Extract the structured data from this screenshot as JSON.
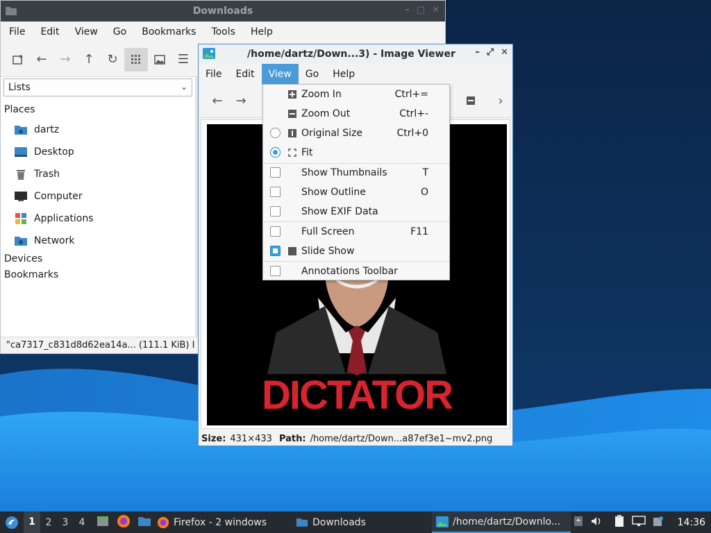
{
  "colors": {
    "accent": "#4a9bd8",
    "titlebar_dark": "#3a3f44",
    "taskbar": "#252a30",
    "wallpaper_dark": "#0d2a4e",
    "wallpaper_light": "#1e8ce8"
  },
  "file_manager": {
    "title": "Downloads",
    "menu": [
      "File",
      "Edit",
      "View",
      "Go",
      "Bookmarks",
      "Tools",
      "Help"
    ],
    "toolbar": [
      "new-tab-icon",
      "back-icon",
      "forward-icon",
      "up-icon",
      "reload-icon",
      "icon-view-icon",
      "thumbnail-view-icon",
      "list-view-icon"
    ],
    "side_pane_mode": "Lists",
    "places_label": "Places",
    "places": [
      {
        "label": "dartz",
        "icon": "home-folder-icon"
      },
      {
        "label": "Desktop",
        "icon": "desktop-icon"
      },
      {
        "label": "Trash",
        "icon": "trash-icon"
      },
      {
        "label": "Computer",
        "icon": "computer-icon"
      },
      {
        "label": "Applications",
        "icon": "applications-icon"
      },
      {
        "label": "Network",
        "icon": "network-icon"
      }
    ],
    "devices_label": "Devices",
    "bookmarks_label": "Bookmarks",
    "status": "\"ca7317_c831d8d62ea14a... (111.1 KiB) I"
  },
  "image_viewer": {
    "title": "/home/dartz/Down...3) - Image Viewer",
    "menu": [
      "File",
      "Edit",
      "View",
      "Go",
      "Help"
    ],
    "active_menu": "View",
    "image_caption": "DICTATOR",
    "status": {
      "size_label": "Size:",
      "size_value": "431×433",
      "path_label": "Path:",
      "path_value": "/home/dartz/Down...a87ef3e1~mv2.png"
    }
  },
  "view_menu": {
    "zoom_in": {
      "label": "Zoom In",
      "shortcut": "Ctrl+="
    },
    "zoom_out": {
      "label": "Zoom Out",
      "shortcut": "Ctrl+-"
    },
    "original_size": {
      "label": "Original Size",
      "shortcut": "Ctrl+0",
      "selected": false
    },
    "fit": {
      "label": "Fit",
      "selected": true
    },
    "show_thumbnails": {
      "label": "Show Thumbnails",
      "shortcut": "T",
      "checked": false
    },
    "show_outline": {
      "label": "Show Outline",
      "shortcut": "O",
      "checked": false
    },
    "show_exif": {
      "label": "Show EXIF Data",
      "checked": false
    },
    "full_screen": {
      "label": "Full Screen",
      "shortcut": "F11",
      "checked": false
    },
    "slide_show": {
      "label": "Slide Show",
      "checked": true
    },
    "annotations_toolbar": {
      "label": "Annotations Toolbar",
      "checked": false
    }
  },
  "taskbar": {
    "workspaces": [
      "1",
      "2",
      "3",
      "4"
    ],
    "current_workspace": "1",
    "tasks": {
      "firefox": "Firefox - 2 windows",
      "downloads": "Downloads",
      "viewer": "/home/dartz/Downlo..."
    },
    "clock": "14:36"
  }
}
